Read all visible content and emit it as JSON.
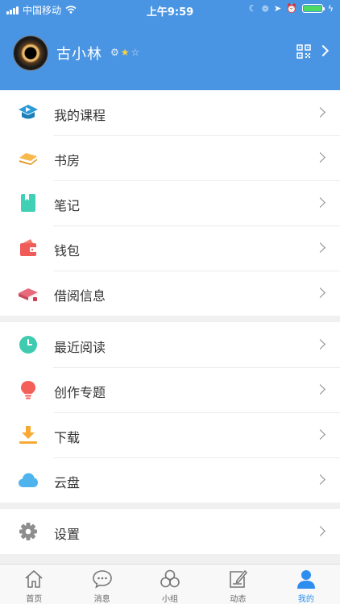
{
  "status_bar": {
    "carrier": "中国移动",
    "time": "上午9:59"
  },
  "profile": {
    "username": "古小林"
  },
  "menu_groups": [
    [
      {
        "name": "my-courses",
        "label": "我的课程",
        "icon": "course-icon"
      },
      {
        "name": "study",
        "label": "书房",
        "icon": "bookshelf-icon"
      },
      {
        "name": "notes",
        "label": "笔记",
        "icon": "notebook-icon"
      },
      {
        "name": "wallet",
        "label": "钱包",
        "icon": "wallet-icon"
      },
      {
        "name": "borrow-info",
        "label": "借阅信息",
        "icon": "books-icon"
      }
    ],
    [
      {
        "name": "recent-reading",
        "label": "最近阅读",
        "icon": "clock-icon"
      },
      {
        "name": "creation-topics",
        "label": "创作专题",
        "icon": "lightbulb-icon"
      },
      {
        "name": "download",
        "label": "下载",
        "icon": "download-icon"
      },
      {
        "name": "cloud-drive",
        "label": "云盘",
        "icon": "cloud-icon"
      }
    ],
    [
      {
        "name": "settings",
        "label": "设置",
        "icon": "gear-icon"
      }
    ]
  ],
  "tabs": [
    {
      "name": "home",
      "label": "首页",
      "icon": "home-icon",
      "active": false
    },
    {
      "name": "messages",
      "label": "消息",
      "icon": "chat-bubble-icon",
      "active": false
    },
    {
      "name": "groups",
      "label": "小组",
      "icon": "circles-icon",
      "active": false
    },
    {
      "name": "activity",
      "label": "动态",
      "icon": "edit-icon",
      "active": false
    },
    {
      "name": "me",
      "label": "我的",
      "icon": "person-icon",
      "active": true
    }
  ],
  "colors": {
    "header_bg": "#4a95e3",
    "tab_active": "#2d8ef0",
    "battery": "#4cd964"
  }
}
